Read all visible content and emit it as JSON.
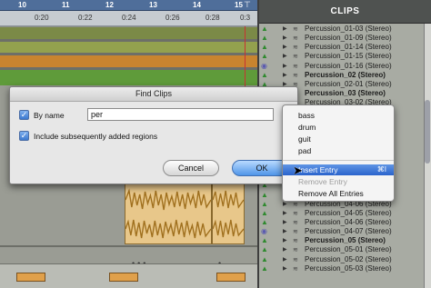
{
  "ruler": {
    "bars": [
      "10",
      "11",
      "12",
      "13",
      "14",
      "15"
    ],
    "times": [
      "0:20",
      "0:22",
      "0:24",
      "0:26",
      "0:28",
      "0:3"
    ]
  },
  "find_dialog": {
    "title": "Find Clips",
    "by_name_label": "By name",
    "by_name_checked": true,
    "search_value": "per",
    "include_label": "Include subsequently added regions",
    "include_checked": true,
    "cancel_label": "Cancel",
    "ok_label": "OK"
  },
  "clips_panel": {
    "header": "CLIPS",
    "rows": [
      {
        "name": "Percussion_01-03 (Stereo)",
        "bold": false
      },
      {
        "name": "Percussion_01-09 (Stereo)",
        "bold": false
      },
      {
        "name": "Percussion_01-14 (Stereo)",
        "bold": false
      },
      {
        "name": "Percussion_01-15 (Stereo)",
        "bold": false
      },
      {
        "name": "Percussion_01-16 (Stereo)",
        "bold": false
      },
      {
        "name": "Percussion_02 (Stereo)",
        "bold": true
      },
      {
        "name": "Percussion_02-01 (Stereo)",
        "bold": false
      },
      {
        "name": "Percussion_03 (Stereo)",
        "bold": true
      },
      {
        "name": "Percussion_03-02 (Stereo)",
        "bold": false
      },
      {
        "name": "",
        "bold": false
      },
      {
        "name": "",
        "bold": false
      },
      {
        "name": "",
        "bold": false
      },
      {
        "name": "",
        "bold": false
      },
      {
        "name": "",
        "bold": false
      },
      {
        "name": "",
        "bold": false
      },
      {
        "name": "",
        "bold": false
      },
      {
        "name": "",
        "bold": false
      },
      {
        "name": "",
        "bold": false
      },
      {
        "name": "",
        "bold": false
      },
      {
        "name": "Percussion_04-06 (Stereo)",
        "bold": false
      },
      {
        "name": "Percussion_04-05 (Stereo)",
        "bold": false
      },
      {
        "name": "Percussion_04-06 (Stereo)",
        "bold": false
      },
      {
        "name": "Percussion_04-07 (Stereo)",
        "bold": false
      },
      {
        "name": "Percussion_05 (Stereo)",
        "bold": true
      },
      {
        "name": "Percussion_05-01 (Stereo)",
        "bold": false
      },
      {
        "name": "Percussion_05-02 (Stereo)",
        "bold": false
      },
      {
        "name": "Percussion_05-03 (Stereo)",
        "bold": false
      }
    ]
  },
  "popup_menu": {
    "items": [
      "bass",
      "drum",
      "guit",
      "pad"
    ],
    "insert_label": "Insert Entry",
    "insert_shortcut": "⌘I",
    "remove_label": "Remove Entry",
    "remove_all_label": "Remove All Entries"
  },
  "colors": {
    "ruler_blue": "#4f6e9a",
    "track_olive": "#7b8a47",
    "track_green": "#5f9b3a",
    "track_orange": "#c8842f",
    "clip_audio": "#e8c78a",
    "highlight": "#2a63cc"
  }
}
